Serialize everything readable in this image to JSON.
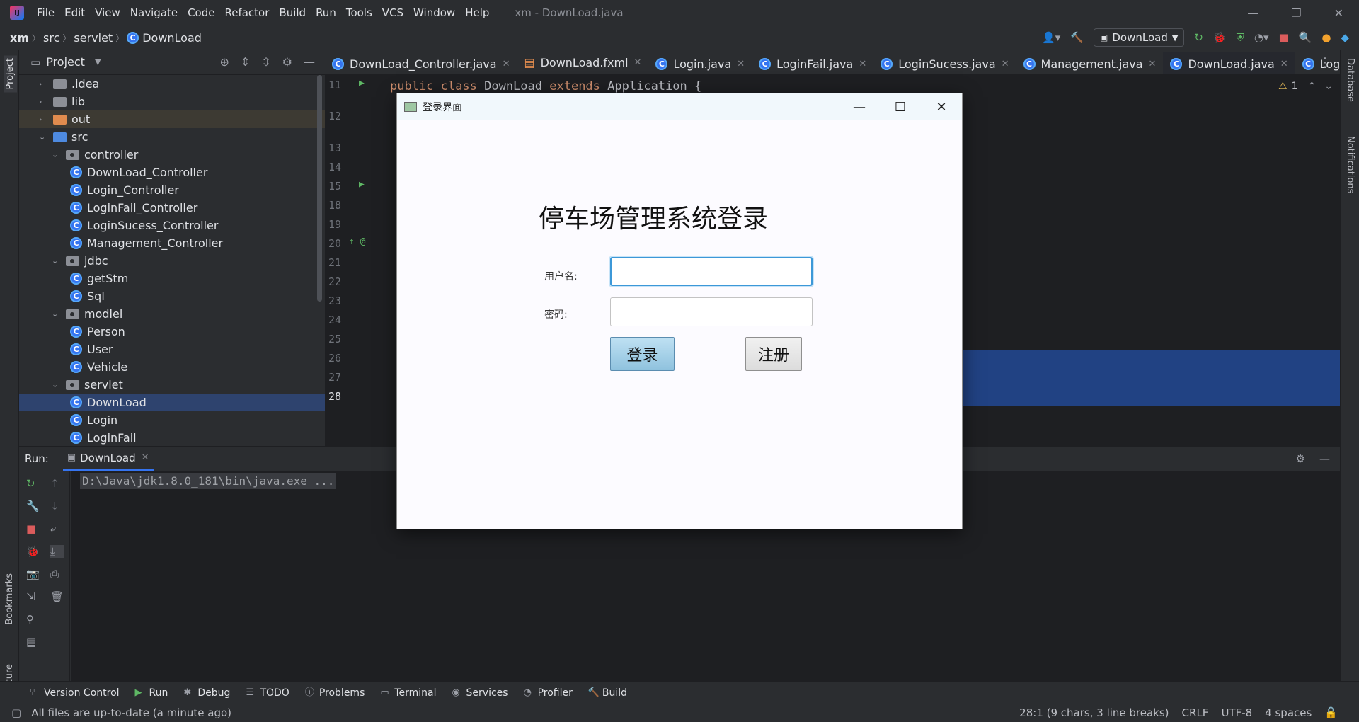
{
  "titlebar": {
    "menu": [
      "File",
      "Edit",
      "View",
      "Navigate",
      "Code",
      "Refactor",
      "Build",
      "Run",
      "Tools",
      "VCS",
      "Window",
      "Help"
    ],
    "window_title": "xm - DownLoad.java"
  },
  "navbar": {
    "breadcrumbs": [
      "xm",
      "src",
      "servlet",
      "DownLoad"
    ],
    "run_config": "DownLoad"
  },
  "project": {
    "header": "Project",
    "tree": [
      {
        "label": ".idea",
        "level": 1,
        "icon": "folder-grey",
        "chev": ">"
      },
      {
        "label": "lib",
        "level": 1,
        "icon": "folder-grey",
        "chev": ">"
      },
      {
        "label": "out",
        "level": 1,
        "icon": "folder-orange",
        "chev": ">"
      },
      {
        "label": "src",
        "level": 1,
        "icon": "folder-blue",
        "chev": "v"
      },
      {
        "label": "controller",
        "level": 2,
        "icon": "package",
        "chev": "v"
      },
      {
        "label": "DownLoad_Controller",
        "level": 3,
        "icon": "class"
      },
      {
        "label": "Login_Controller",
        "level": 3,
        "icon": "class"
      },
      {
        "label": "LoginFail_Controller",
        "level": 3,
        "icon": "class"
      },
      {
        "label": "LoginSucess_Controller",
        "level": 3,
        "icon": "class"
      },
      {
        "label": "Management_Controller",
        "level": 3,
        "icon": "class"
      },
      {
        "label": "jdbc",
        "level": 2,
        "icon": "package",
        "chev": "v"
      },
      {
        "label": "getStm",
        "level": 3,
        "icon": "class"
      },
      {
        "label": "Sql",
        "level": 3,
        "icon": "class"
      },
      {
        "label": "modlel",
        "level": 2,
        "icon": "package",
        "chev": "v"
      },
      {
        "label": "Person",
        "level": 3,
        "icon": "class"
      },
      {
        "label": "User",
        "level": 3,
        "icon": "class"
      },
      {
        "label": "Vehicle",
        "level": 3,
        "icon": "class"
      },
      {
        "label": "servlet",
        "level": 2,
        "icon": "package",
        "chev": "v"
      },
      {
        "label": "DownLoad",
        "level": 3,
        "icon": "class",
        "selected": true
      },
      {
        "label": "Login",
        "level": 3,
        "icon": "class"
      },
      {
        "label": "LoginFail",
        "level": 3,
        "icon": "class"
      }
    ]
  },
  "tabs": [
    {
      "label": "DownLoad_Controller.java"
    },
    {
      "label": "DownLoad.fxml"
    },
    {
      "label": "Login.java"
    },
    {
      "label": "LoginFail.java"
    },
    {
      "label": "LoginSucess.java"
    },
    {
      "label": "Management.java"
    },
    {
      "label": "DownLoad.java",
      "active": true
    },
    {
      "label": "Login"
    }
  ],
  "editor": {
    "line_numbers": [
      "11",
      "12",
      "13",
      "14",
      "15",
      "18",
      "19",
      "20",
      "21",
      "22",
      "23",
      "24",
      "25",
      "26",
      "27",
      "28"
    ],
    "code_line_11": {
      "kw1": "public",
      "kw2": "class",
      "name": "DownLoad",
      "kw3": "extends",
      "parent": "Application {"
    },
    "warning_count": "1"
  },
  "run_panel": {
    "label": "Run:",
    "tab": "DownLoad",
    "console_line": "D:\\Java\\jdk1.8.0_181\\bin\\java.exe ..."
  },
  "bottom_tabs": [
    "Version Control",
    "Run",
    "Debug",
    "TODO",
    "Problems",
    "Terminal",
    "Services",
    "Profiler",
    "Build"
  ],
  "side_labels": {
    "left_top": "Project",
    "left_bookmarks": "Bookmarks",
    "left_structure": "Structure",
    "right_db": "Database",
    "right_notif": "Notifications"
  },
  "status": {
    "message": "All files are up-to-date (a minute ago)",
    "position": "28:1 (9 chars, 3 line breaks)",
    "line_sep": "CRLF",
    "encoding": "UTF-8",
    "indent": "4 spaces"
  },
  "dialog": {
    "title": "登录界面",
    "heading": "停车场管理系统登录",
    "username_label": "用户名:",
    "password_label": "密码:",
    "login_button": "登录",
    "register_button": "注册"
  }
}
